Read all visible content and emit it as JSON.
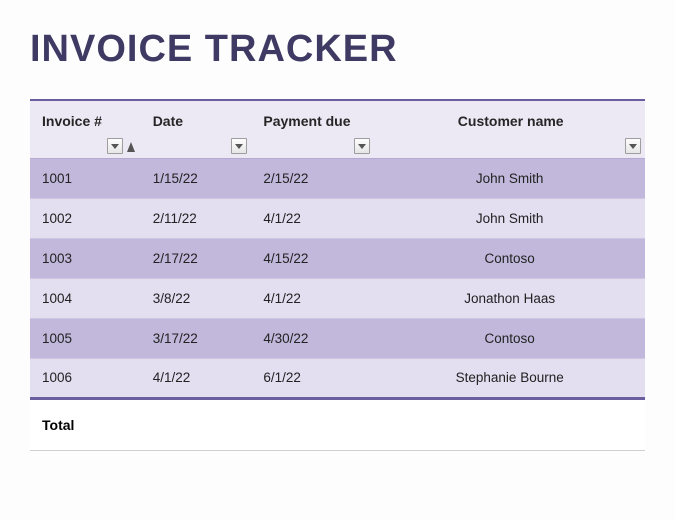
{
  "title": "INVOICE TRACKER",
  "columns": {
    "invoice": "Invoice #",
    "date": "Date",
    "payment_due": "Payment due",
    "customer_name": "Customer name"
  },
  "rows": [
    {
      "invoice": "1001",
      "date": "1/15/22",
      "payment_due": "2/15/22",
      "customer_name": "John Smith"
    },
    {
      "invoice": "1002",
      "date": "2/11/22",
      "payment_due": "4/1/22",
      "customer_name": "John Smith"
    },
    {
      "invoice": "1003",
      "date": "2/17/22",
      "payment_due": "4/15/22",
      "customer_name": "Contoso"
    },
    {
      "invoice": "1004",
      "date": "3/8/22",
      "payment_due": "4/1/22",
      "customer_name": "Jonathon Haas"
    },
    {
      "invoice": "1005",
      "date": "3/17/22",
      "payment_due": "4/30/22",
      "customer_name": "Contoso"
    },
    {
      "invoice": "1006",
      "date": "4/1/22",
      "payment_due": "6/1/22",
      "customer_name": "Stephanie Bourne"
    }
  ],
  "footer": {
    "label": "Total"
  }
}
